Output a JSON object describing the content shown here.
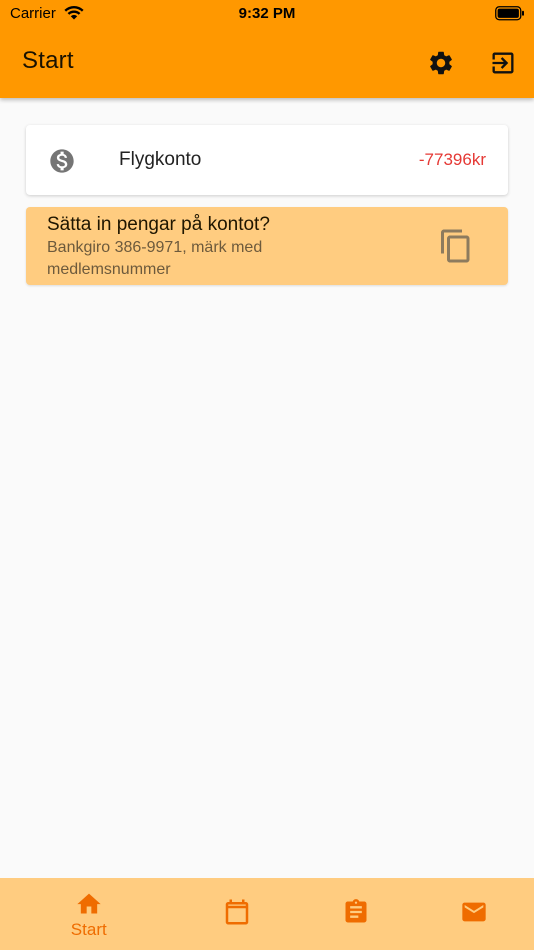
{
  "status_bar": {
    "carrier": "Carrier",
    "time": "9:32 PM"
  },
  "header": {
    "title": "Start"
  },
  "account": {
    "name": "Flygkonto",
    "balance": "-77396kr"
  },
  "deposit": {
    "title": "Sätta in pengar på kontot?",
    "subtitle": "Bankgiro 386-9971, märk med medlemsnummer"
  },
  "bottom_nav": {
    "start_label": "Start"
  },
  "colors": {
    "header": "#ff9800",
    "deposit_bg": "#ffcc80",
    "nav_bg": "#ffcc80",
    "nav_active": "#ef6c00",
    "balance_negative": "#e53935"
  },
  "icons": [
    "wifi-icon",
    "battery-icon",
    "settings-icon",
    "logout-icon",
    "dollar-coin-icon",
    "copy-icon",
    "home-icon",
    "calendar-icon",
    "clipboard-icon",
    "mail-icon"
  ]
}
